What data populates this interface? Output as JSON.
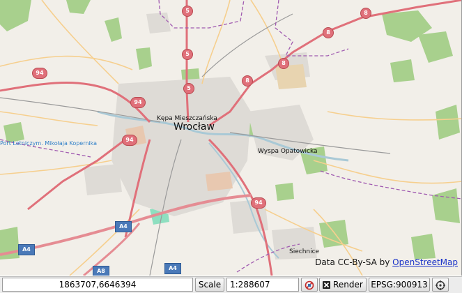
{
  "map": {
    "city_label": "Wrocław",
    "labels": {
      "kepa": "Kępa Mieszczańska",
      "wyspa": "Wyspa Opatowicka",
      "port": "Port Lotniczym. Mikołaja Kopernika",
      "siechnice": "Siechnice"
    },
    "road_shields": {
      "r94_left": "94",
      "r94_center": "94",
      "r94_lower": "94",
      "r94_south": "94",
      "r5_top": "5",
      "r5_mid": "5",
      "r5_low": "5",
      "r8_ne_top": "8",
      "r8_ne_mid": "8",
      "r8_ne_low": "8",
      "r8_center": "8",
      "a4_center": "A4",
      "a4_left": "A4",
      "a4_bottom": "A4",
      "a8_bottom": "A8"
    },
    "attribution_prefix": "Data CC-By-SA by ",
    "attribution_link": "OpenStreetMap",
    "colors": {
      "land": "#f2efe9",
      "green": "#9ecb7a",
      "residential": "#dcdcdc",
      "primary_road": "#e0707a",
      "secondary_road": "#f7d7a0",
      "water": "#b5d0d0",
      "boundary": "#a05ab0"
    }
  },
  "toolbar": {
    "coordinates": "1863707,6646394",
    "scale_button": "Scale",
    "scale_value": "1:288607",
    "clear_icon": "no-entry-icon",
    "render_icon": "close-x-icon",
    "render_label": "Render",
    "projection": "EPSG:900913",
    "locate_icon": "crosshair-icon"
  }
}
